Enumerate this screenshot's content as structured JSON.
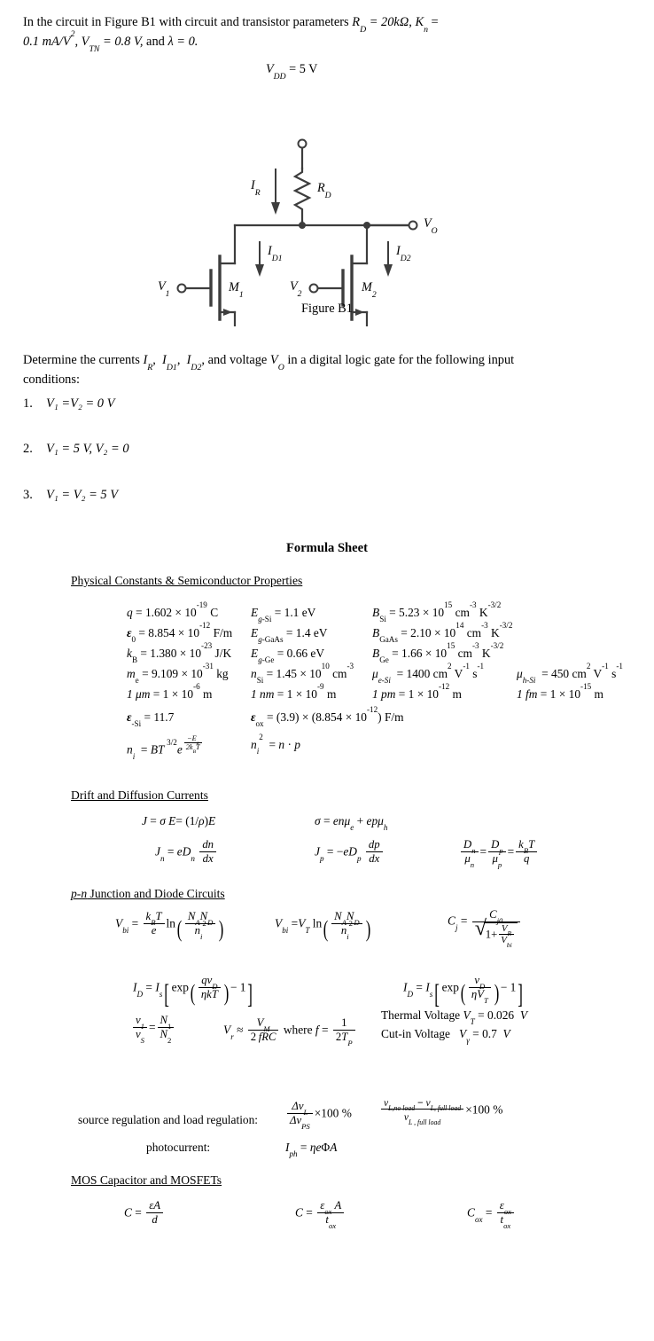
{
  "document": {
    "intro_line1_pre": "In the circuit in Figure B1 with circuit and transistor parameters ",
    "intro_R_D": "R",
    "intro_R_D_sub": "D",
    "intro_R_D_val": " = 20kΩ,",
    "intro_K_n": "K",
    "intro_K_n_sub": "n",
    "intro_eq": " =",
    "intro_line2": "0.1 mA/V",
    "intro_line2_sup": "2",
    "intro_V_TN": "V",
    "intro_V_TN_sub": "TN",
    "intro_V_TN_val": " = 0.8 V,",
    "intro_and": " and ",
    "intro_lambda": "λ = 0."
  },
  "figure": {
    "caption": "Figure B1",
    "vdd_label": "V",
    "vdd_sub": "DD",
    "vdd_value": " = 5 V",
    "resistor_label": "R",
    "resistor_sub": "D",
    "current_ir": "I",
    "current_ir_sub": "R",
    "current_id1": "I",
    "current_id1_sub": "D1",
    "current_id2": "I",
    "current_id2_sub": "D2",
    "output_label": "V",
    "output_sub": "O",
    "input1_label": "V",
    "input1_sub": "1",
    "input2_label": "V",
    "input2_sub": "2",
    "transistor1": "M",
    "transistor1_sub": "1",
    "transistor2": "M",
    "transistor2_sub": "2"
  },
  "question": {
    "text_a": "Determine the currents ",
    "i_r": "I",
    "i_r_sub": "R",
    "i_d1": "I",
    "i_d1_sub": "D1",
    "i_d2": "I",
    "i_d2_sub": "D2",
    "text_b": ", and voltage ",
    "v_o": "V",
    "v_o_sub": "O",
    "text_c": " in a digital logic gate for the following input",
    "text_d": "conditions:",
    "conditions": [
      {
        "num": "1.",
        "expr": "V₁ =V₂ = 0 V"
      },
      {
        "num": "2.",
        "expr": "V₁ = 5 V, V₂ = 0"
      },
      {
        "num": "3.",
        "expr": "V₁ = V₂ = 5 V"
      }
    ]
  },
  "formula_sheet": {
    "title": "Formula Sheet",
    "sections": [
      {
        "heading": "Physical Constants & Semiconductor Properties"
      },
      {
        "heading": "Drift and Diffusion Currents"
      },
      {
        "heading": "p-n Junction and Diode Circuits"
      },
      {
        "heading": "MOS Capacitor and MOSFETs"
      }
    ],
    "constants": {
      "row1": [
        "q = 1.602 × 10⁻¹⁹ C",
        "Eg-Si = 1.1 eV",
        "BSi = 5.23 × 10¹⁵ cm⁻³ K⁻³ᐟ²"
      ],
      "row2": [
        "ε₀ = 8.854 × 10⁻¹² F/m",
        "Eg-GaAs = 1.4 eV",
        "BGaAs = 2.10 × 10¹⁴ cm⁻³ K⁻³ᐟ²"
      ],
      "row3": [
        "kB = 1.380 × 10⁻²³ J/K",
        "Eg-Ge = 0.66 eV",
        "BGe = 1.66 × 10¹⁵ cm⁻³ K⁻³ᐟ²"
      ],
      "row4": [
        "me = 9.109 × 10⁻³¹ kg",
        "nSi = 1.45 × 10¹⁰ cm⁻³",
        "μe-Si = 1400 cm² V⁻¹ s⁻¹",
        "μh-Si = 450 cm² V⁻¹ s⁻¹"
      ],
      "row5": [
        "1 μm = 1 × 10⁻⁶ m",
        "1 nm = 1 × 10⁻⁹ m",
        "1 pm = 1 × 10⁻¹² m",
        "1 fm = 1 × 10⁻¹⁵ m"
      ],
      "row6": [
        "ε-Si = 11.7",
        "εox = (3.9) × (8.854 × 10⁻¹²) F/m"
      ],
      "row7": [
        "ni = BT^3/2 e^(−Eg/2kBT)",
        "ni² = n · p"
      ]
    },
    "drift": {
      "eq1": "J = σE = (1/ρ)E",
      "eq2": "σ = enμe + epμh",
      "eq3": "Jn = eDn dn/dx",
      "eq4": "Jp = −eDp dp/dx",
      "eq5": "Dn/μn = Dp/μp = kBT/q"
    },
    "pn": {
      "eq1": "Vbi = (kBT/e) ln(NAND/ni²)",
      "eq2": "Vbi = VT ln(NAND/ni²)",
      "eq3": "Cj = Cj0 / sqrt(1 + VR/Vbi)",
      "eq4": "ID = Is[exp(qvD/ηkT) − 1]",
      "eq5": "ID = Is[exp(vD/ηVT) − 1]",
      "eq6": "v1/vS = N1/N2",
      "eq7": "Vr ≈ VM/(2fRC) where f = 1/(2TP)",
      "note1": "Thermal Voltage",
      "note1_val": "VT = 0.026 V",
      "note2": "Cut-in Voltage",
      "note2_val": "Vγ = 0.7 V"
    },
    "regulation": {
      "label": "source regulation and load regulation:",
      "eq1": "ΔvL/ΔvPS ×100 %",
      "eq2": "(vL,no load − vL,full load)/vL,full load ×100 %",
      "photo_label": "photocurrent:",
      "photo_eq": "Iph = ηeΦA"
    },
    "mos": {
      "eq1": "C = εA/d",
      "eq2": "C = εox A / tox",
      "eq3": "Cox = εox / tox"
    }
  },
  "colors": {
    "text": "#000000",
    "background": "#ffffff",
    "wire": "#3d3d3d",
    "label_blue": "#2a3b66"
  }
}
